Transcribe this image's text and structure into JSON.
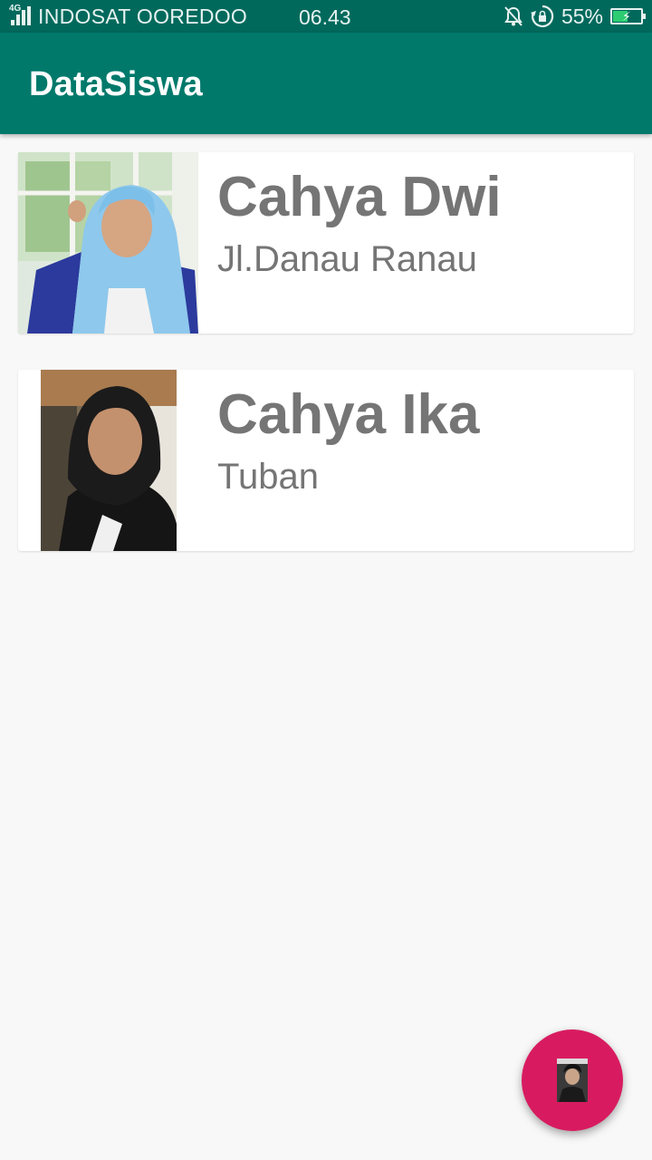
{
  "status_bar": {
    "network_type": "4G",
    "carrier": "INDOSAT OOREDOO",
    "time": "06.43",
    "battery_percent": "55%",
    "battery_level": 0.55,
    "icons": [
      "signal-icon",
      "mute-icon",
      "rotation-lock-icon",
      "battery-charging-icon"
    ]
  },
  "app_bar": {
    "title": "DataSiswa",
    "color": "#00796b"
  },
  "students": [
    {
      "name": "Cahya Dwi",
      "address": "Jl.Danau Ranau"
    },
    {
      "name": "Cahya Ika",
      "address": "Tuban"
    }
  ],
  "fab": {
    "color": "#d81b60",
    "icon": "person-photo-icon"
  }
}
